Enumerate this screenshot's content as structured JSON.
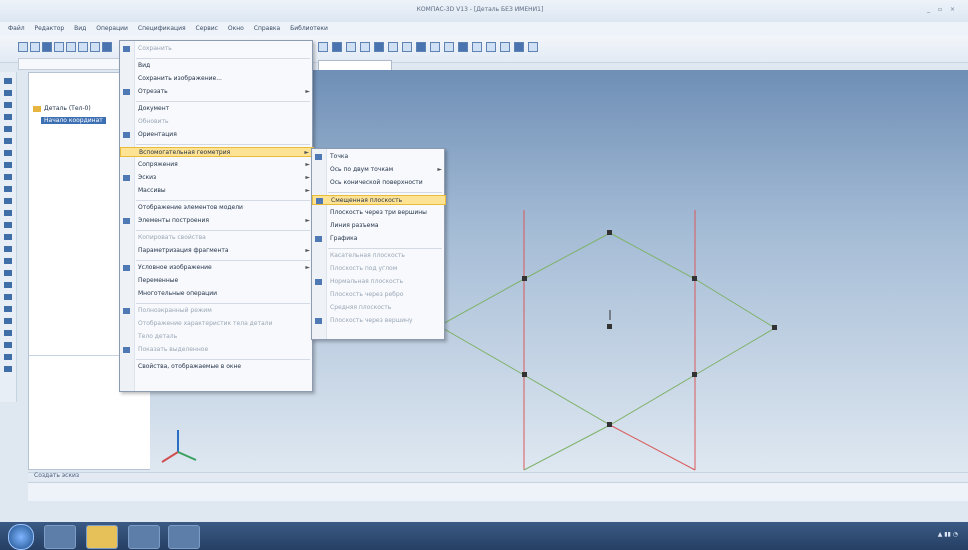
{
  "window": {
    "title": "КОМПАС-3D V13 - [Деталь БЕЗ ИМЕНИ1]",
    "controls": "_ ▫ ×"
  },
  "menubar": {
    "items": [
      "Файл",
      "Редактор",
      "Вид",
      "Операции",
      "Спецификация",
      "Сервис",
      "Окно",
      "Справка",
      "Библиотеки"
    ]
  },
  "tree": {
    "root": "Деталь (Тел-0)",
    "child": "Начало координат"
  },
  "context_menu": {
    "items": [
      {
        "label": "Сохранить",
        "disabled": true
      },
      {
        "label": "Вид",
        "disabled": false
      },
      {
        "label": "Сохранить изображение...",
        "disabled": false
      },
      {
        "label": "Отрезать",
        "disabled": false,
        "submenu": true
      },
      {
        "label": "Документ",
        "disabled": false
      },
      {
        "label": "Обновить",
        "disabled": true
      },
      {
        "label": "Ориентация",
        "disabled": false
      },
      {
        "label": "Вспомогательная геометрия",
        "disabled": false,
        "submenu": true,
        "highlight": true
      },
      {
        "label": "Сопряжения",
        "disabled": false,
        "submenu": true
      },
      {
        "label": "Эскиз",
        "disabled": false,
        "submenu": true
      },
      {
        "label": "Массивы",
        "disabled": false,
        "submenu": true
      },
      {
        "label": "Отображение элементов модели",
        "disabled": false
      },
      {
        "label": "Элементы построения",
        "disabled": false,
        "submenu": true
      },
      {
        "label": "Копировать свойства",
        "disabled": true
      },
      {
        "label": "Параметризация фрагмента",
        "disabled": false,
        "submenu": true
      },
      {
        "label": "Условное изображение",
        "disabled": false,
        "submenu": true
      },
      {
        "label": "Переменные",
        "disabled": false
      },
      {
        "label": "Многотельные операции",
        "disabled": false
      },
      {
        "label": "Полноэкранный режим",
        "disabled": true
      },
      {
        "label": "Отображение характеристик тела детали",
        "disabled": true
      },
      {
        "label": "Тело деталь",
        "disabled": true
      },
      {
        "label": "Показать выделенное",
        "disabled": true
      },
      {
        "label": "Свойства, отображаемые в окне",
        "disabled": false
      }
    ]
  },
  "submenu": {
    "items": [
      {
        "label": "Точка",
        "disabled": false
      },
      {
        "label": "Ось по двум точкам",
        "disabled": false,
        "submenu": true
      },
      {
        "label": "Ось конической поверхности",
        "disabled": false
      },
      {
        "label": "Смещенная плоскость",
        "disabled": false,
        "highlight": true
      },
      {
        "label": "Плоскость через три вершины",
        "disabled": false
      },
      {
        "label": "Линия разъема",
        "disabled": false
      },
      {
        "label": "Графика",
        "disabled": false
      },
      {
        "label": "Касательная плоскость",
        "disabled": true
      },
      {
        "label": "Плоскость под углом",
        "disabled": true
      },
      {
        "label": "Нормальная плоскость",
        "disabled": true
      },
      {
        "label": "Плоскость через ребро",
        "disabled": true
      },
      {
        "label": "Средняя плоскость",
        "disabled": true
      },
      {
        "label": "Плоскость через вершину",
        "disabled": true
      }
    ]
  },
  "status": {
    "text": "Создать эскиз"
  },
  "colors": {
    "viewport_top": "#6f8fb6",
    "viewport_bottom": "#dfe8f1",
    "menu_highlight": "#ffe394",
    "plane_green": "#7fb26a",
    "plane_red": "#d85a5a",
    "point": "#333333"
  }
}
